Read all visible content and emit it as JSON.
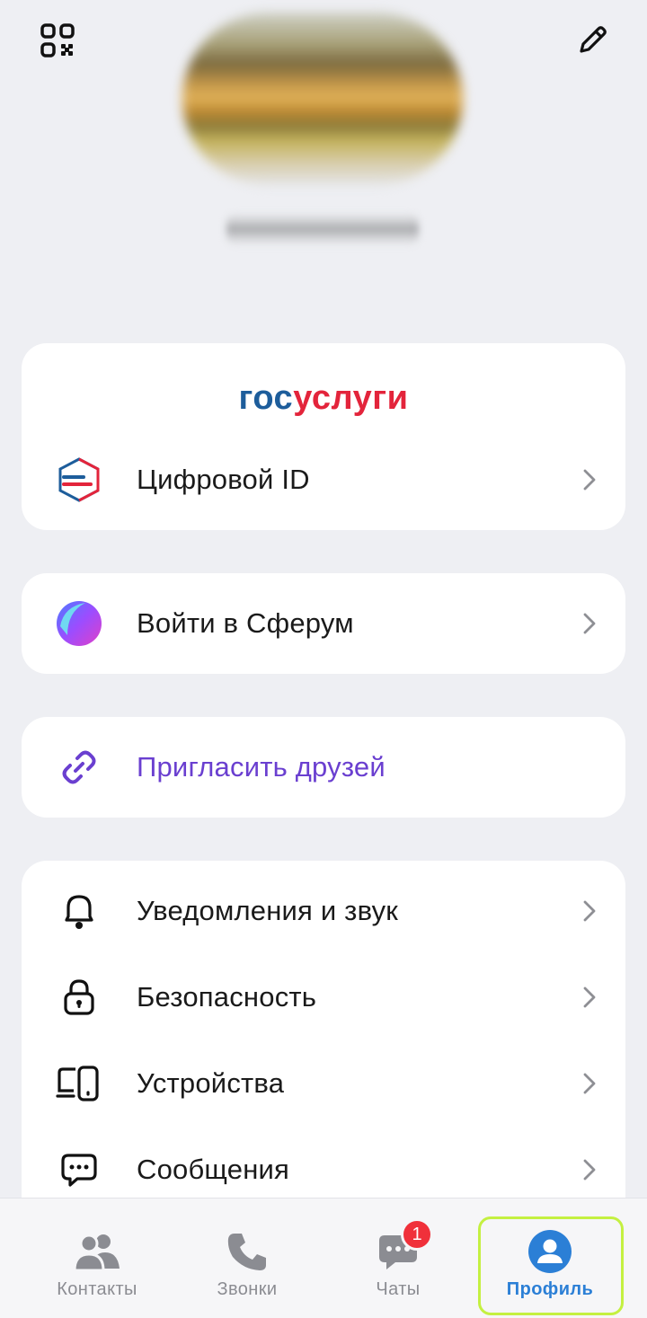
{
  "header": {
    "qr_icon": "qr-code-icon",
    "edit_icon": "pencil-icon"
  },
  "gosuslugi": {
    "logo_part1": "гос",
    "logo_part2": "услуги",
    "logo_colors": {
      "part1": "#1d5d9b",
      "part2": "#e3243b"
    },
    "item": {
      "label": "Цифровой ID",
      "icon": "digital-id-icon"
    }
  },
  "sferum": {
    "label": "Войти в Сферум",
    "icon": "sferum-icon"
  },
  "invite": {
    "label": "Пригласить друзей",
    "icon": "link-icon",
    "color": "#6a3fd0"
  },
  "settings": {
    "items": [
      {
        "label": "Уведомления и звук",
        "icon": "bell-icon"
      },
      {
        "label": "Безопасность",
        "icon": "lock-icon"
      },
      {
        "label": "Устройства",
        "icon": "devices-icon"
      },
      {
        "label": "Сообщения",
        "icon": "message-icon"
      }
    ]
  },
  "tabbar": {
    "tabs": [
      {
        "label": "Контакты",
        "icon": "contacts-icon"
      },
      {
        "label": "Звонки",
        "icon": "phone-icon"
      },
      {
        "label": "Чаты",
        "icon": "chat-icon",
        "badge": "1"
      },
      {
        "label": "Профиль",
        "icon": "profile-icon",
        "active": true
      }
    ],
    "active_color": "#2b7fd6",
    "badge_color": "#f0303a"
  }
}
